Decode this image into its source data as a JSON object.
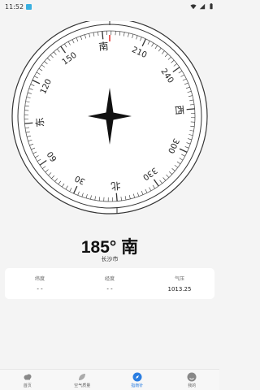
{
  "status_bar": {
    "time": "11:52"
  },
  "compass": {
    "heading_deg": 185,
    "rotation_deg": -185,
    "ring_labels": [
      {
        "text": "北",
        "deg": 0
      },
      {
        "text": "30",
        "deg": 30
      },
      {
        "text": "60",
        "deg": 60
      },
      {
        "text": "东",
        "deg": 90
      },
      {
        "text": "120",
        "deg": 120
      },
      {
        "text": "150",
        "deg": 150
      },
      {
        "text": "南",
        "deg": 180
      },
      {
        "text": "210",
        "deg": 210
      },
      {
        "text": "240",
        "deg": 240
      },
      {
        "text": "西",
        "deg": 270
      },
      {
        "text": "300",
        "deg": 300
      },
      {
        "text": "330",
        "deg": 330
      }
    ],
    "indicator_color": "#e53935"
  },
  "reading": {
    "heading": "185° 南",
    "city": "长沙市"
  },
  "info": [
    {
      "label": "纬度",
      "value": "- -"
    },
    {
      "label": "经度",
      "value": "- -"
    },
    {
      "label": "气压",
      "value": "1013.25"
    }
  ],
  "nav": [
    {
      "label": "首页",
      "icon": "cloud-icon",
      "active": false
    },
    {
      "label": "空气质量",
      "icon": "leaf-icon",
      "active": false
    },
    {
      "label": "指南针",
      "icon": "compass-icon",
      "active": true
    },
    {
      "label": "我的",
      "icon": "profile-icon",
      "active": false
    }
  ],
  "colors": {
    "accent": "#2a7de1",
    "background": "#f4f4f4"
  }
}
